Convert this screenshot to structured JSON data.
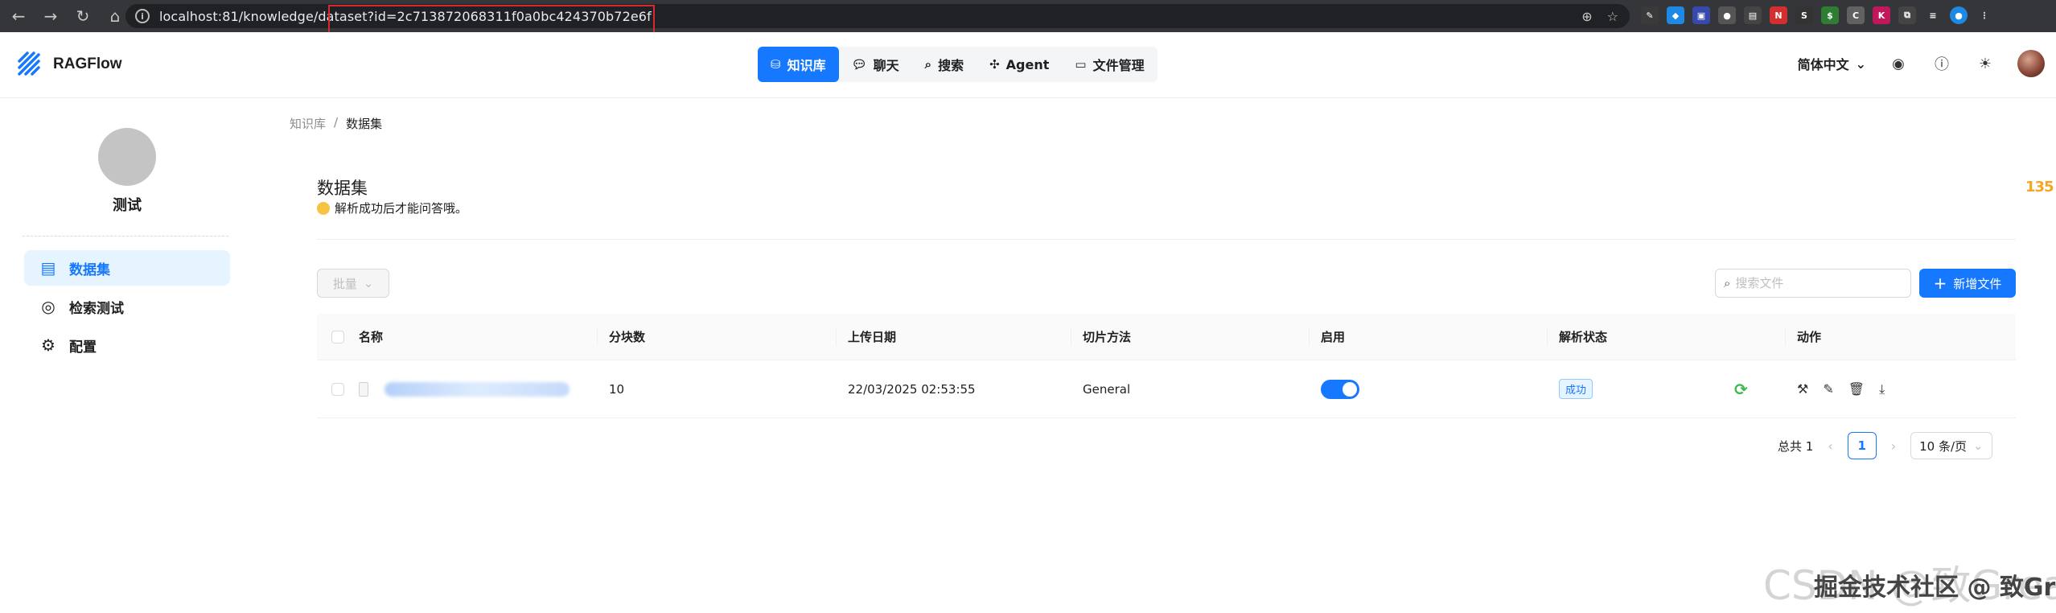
{
  "browser": {
    "url": "localhost:81/knowledge/dataset?id=2c713872068311f0a0bc424370b72e6f"
  },
  "app": {
    "name": "RAGFlow"
  },
  "top_nav": {
    "tabs": [
      {
        "label": "知识库",
        "icon": "database-icon",
        "active": true
      },
      {
        "label": "聊天",
        "icon": "chat-icon",
        "active": false
      },
      {
        "label": "搜索",
        "icon": "search-icon",
        "active": false
      },
      {
        "label": "Agent",
        "icon": "agent-icon",
        "active": false
      },
      {
        "label": "文件管理",
        "icon": "folder-icon",
        "active": false
      }
    ]
  },
  "header_right": {
    "language": "简体中文"
  },
  "sidebar": {
    "kb_name": "测试",
    "items": [
      {
        "label": "数据集",
        "icon": "document-icon",
        "active": true
      },
      {
        "label": "检索测试",
        "icon": "target-icon",
        "active": false
      },
      {
        "label": "配置",
        "icon": "gear-icon",
        "active": false
      }
    ]
  },
  "breadcrumb": {
    "parent": "知识库",
    "separator": "/",
    "current": "数据集"
  },
  "page": {
    "title": "数据集",
    "description": "解析成功后才能问答哦。"
  },
  "toolbar": {
    "batch_label": "批量",
    "search_placeholder": "搜索文件",
    "add_label": "新增文件"
  },
  "table": {
    "columns": [
      "名称",
      "分块数",
      "上传日期",
      "切片方法",
      "启用",
      "解析状态",
      "动作"
    ],
    "rows": [
      {
        "chunks": "10",
        "upload_date": "22/03/2025 02:53:55",
        "method": "General",
        "enabled": true,
        "status": "成功"
      }
    ]
  },
  "pagination": {
    "total_label": "总共 1",
    "current_page": "1",
    "page_size": "10 条/页"
  },
  "floating_badge": "135",
  "watermark": {
    "text": "CSDN @致Great",
    "sub": "掘金技术社区 @ 致Great"
  },
  "colors": {
    "primary": "#1677ff",
    "success": "#3fb950",
    "highlight_box": "#d9292f"
  }
}
